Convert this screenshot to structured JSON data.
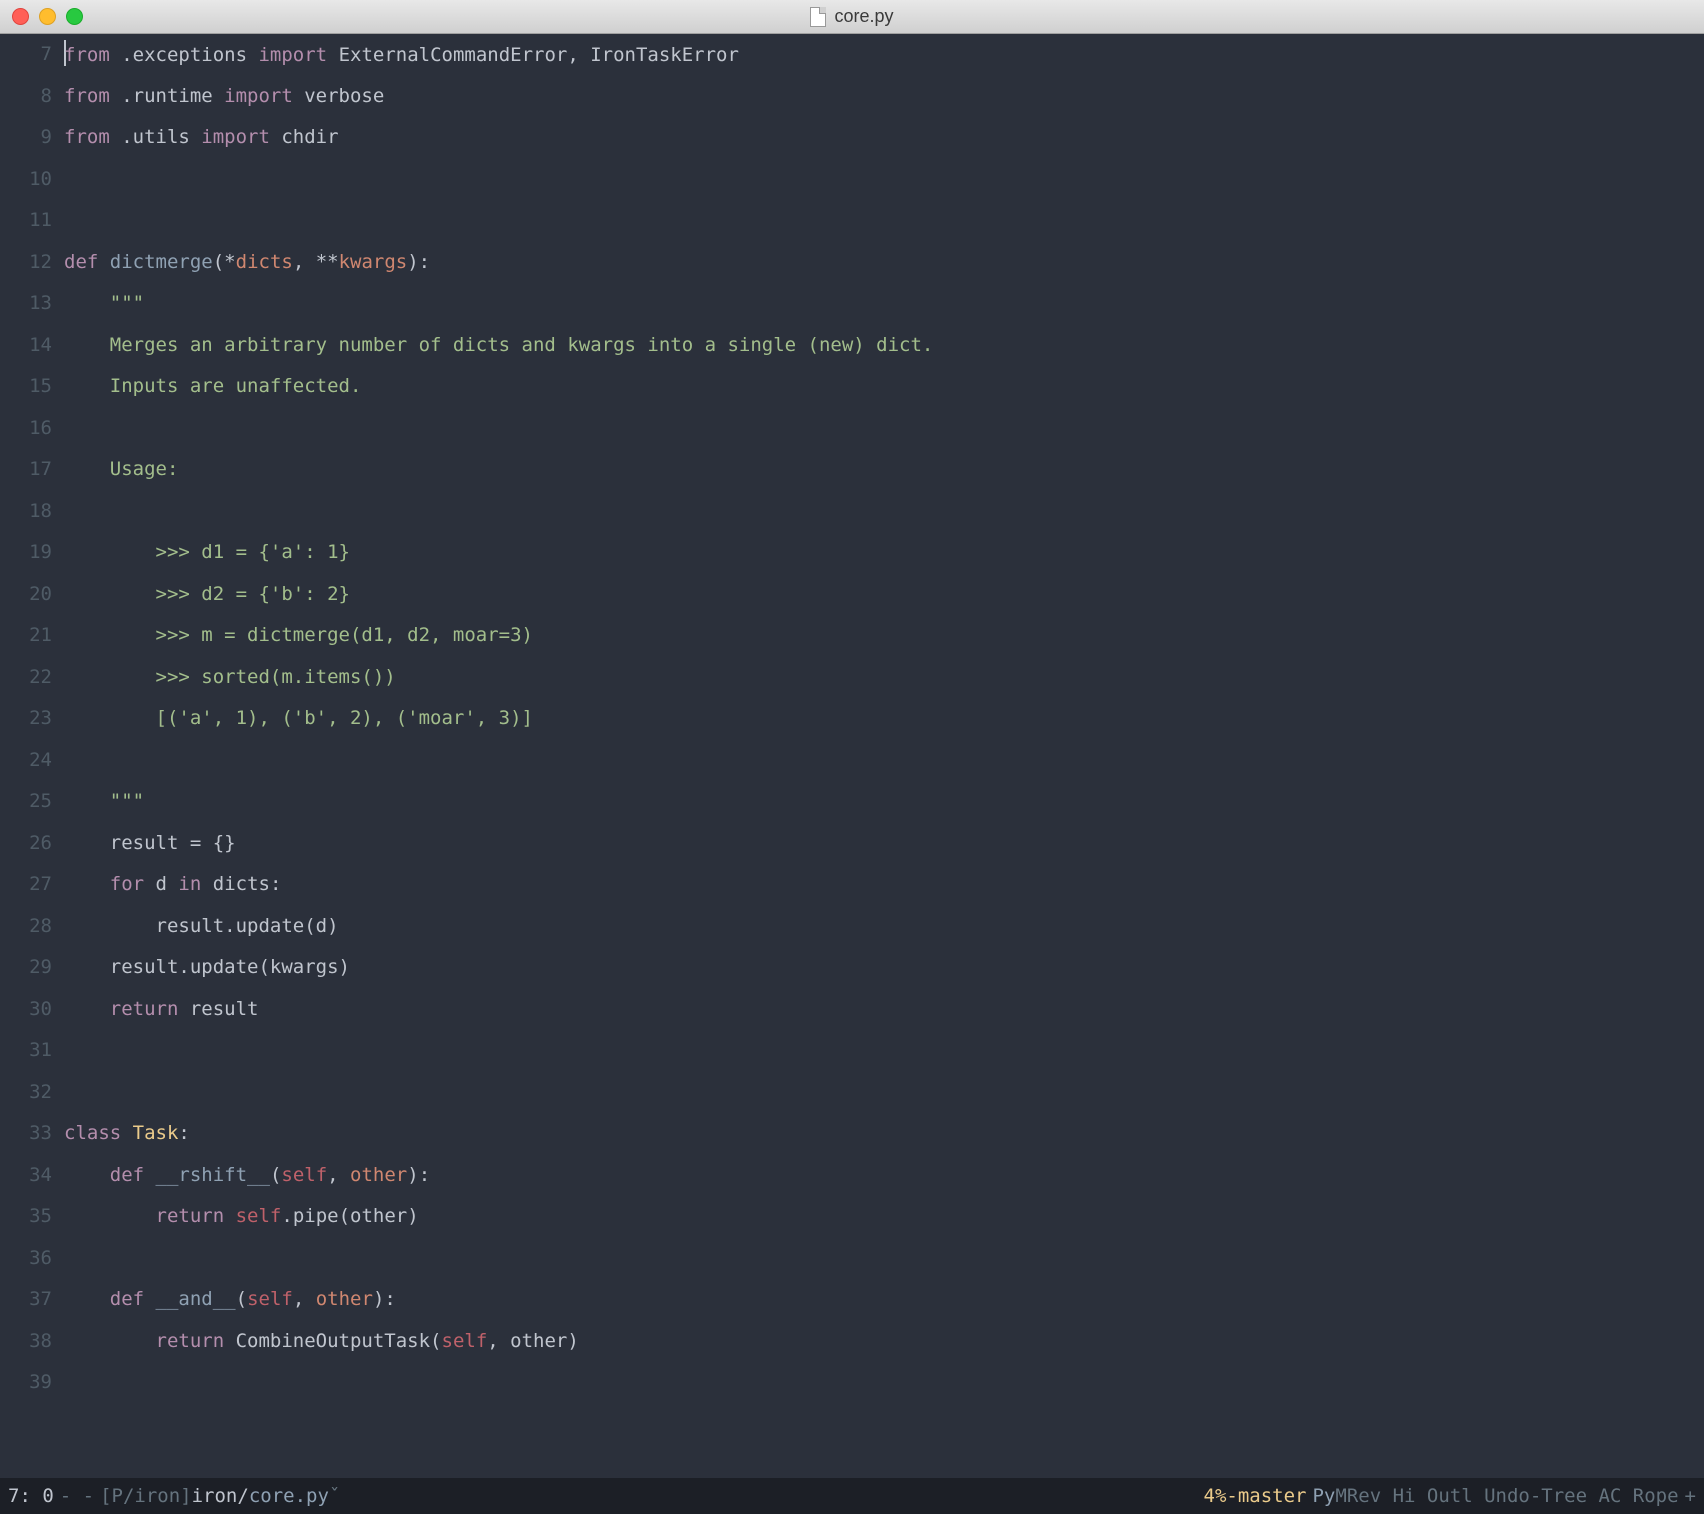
{
  "window": {
    "title": "core.py"
  },
  "gutter": {
    "start": 7,
    "end": 39
  },
  "code": {
    "lines": [
      {
        "n": 7,
        "tokens": [
          {
            "c": "kw",
            "t": "from"
          },
          {
            "c": "var",
            "t": " .exceptions "
          },
          {
            "c": "kw",
            "t": "import"
          },
          {
            "c": "var",
            "t": " ExternalCommandError, IronTaskError"
          }
        ],
        "cursor_before": true
      },
      {
        "n": 8,
        "tokens": [
          {
            "c": "kw",
            "t": "from"
          },
          {
            "c": "var",
            "t": " .runtime "
          },
          {
            "c": "kw",
            "t": "import"
          },
          {
            "c": "var",
            "t": " verbose"
          }
        ]
      },
      {
        "n": 9,
        "tokens": [
          {
            "c": "kw",
            "t": "from"
          },
          {
            "c": "var",
            "t": " .utils "
          },
          {
            "c": "kw",
            "t": "import"
          },
          {
            "c": "var",
            "t": " chdir"
          }
        ]
      },
      {
        "n": 10,
        "tokens": []
      },
      {
        "n": 11,
        "tokens": []
      },
      {
        "n": 12,
        "tokens": [
          {
            "c": "kw",
            "t": "def"
          },
          {
            "c": "var",
            "t": " "
          },
          {
            "c": "fn",
            "t": "dictmerge"
          },
          {
            "c": "var",
            "t": "(*"
          },
          {
            "c": "param",
            "t": "dicts"
          },
          {
            "c": "var",
            "t": ", **"
          },
          {
            "c": "param",
            "t": "kwargs"
          },
          {
            "c": "var",
            "t": "):"
          }
        ]
      },
      {
        "n": 13,
        "tokens": [
          {
            "c": "str",
            "t": "    \"\"\""
          }
        ]
      },
      {
        "n": 14,
        "tokens": [
          {
            "c": "str",
            "t": "    Merges an arbitrary number of dicts and kwargs into a single (new) dict."
          }
        ]
      },
      {
        "n": 15,
        "tokens": [
          {
            "c": "str",
            "t": "    Inputs are unaffected."
          }
        ]
      },
      {
        "n": 16,
        "tokens": []
      },
      {
        "n": 17,
        "tokens": [
          {
            "c": "str",
            "t": "    Usage:"
          }
        ]
      },
      {
        "n": 18,
        "tokens": []
      },
      {
        "n": 19,
        "tokens": [
          {
            "c": "str",
            "t": "        >>> d1 = {'a': 1}"
          }
        ]
      },
      {
        "n": 20,
        "tokens": [
          {
            "c": "str",
            "t": "        >>> d2 = {'b': 2}"
          }
        ]
      },
      {
        "n": 21,
        "tokens": [
          {
            "c": "str",
            "t": "        >>> m = dictmerge(d1, d2, moar=3)"
          }
        ]
      },
      {
        "n": 22,
        "tokens": [
          {
            "c": "str",
            "t": "        >>> sorted(m.items())"
          }
        ]
      },
      {
        "n": 23,
        "tokens": [
          {
            "c": "str",
            "t": "        [('a', 1), ('b', 2), ('moar', 3)]"
          }
        ]
      },
      {
        "n": 24,
        "tokens": []
      },
      {
        "n": 25,
        "tokens": [
          {
            "c": "str",
            "t": "    \"\"\""
          }
        ]
      },
      {
        "n": 26,
        "tokens": [
          {
            "c": "var",
            "t": "    result = {}"
          }
        ]
      },
      {
        "n": 27,
        "tokens": [
          {
            "c": "var",
            "t": "    "
          },
          {
            "c": "kw",
            "t": "for"
          },
          {
            "c": "var",
            "t": " d "
          },
          {
            "c": "kw",
            "t": "in"
          },
          {
            "c": "var",
            "t": " dicts:"
          }
        ]
      },
      {
        "n": 28,
        "tokens": [
          {
            "c": "var",
            "t": "        result.update(d)"
          }
        ]
      },
      {
        "n": 29,
        "tokens": [
          {
            "c": "var",
            "t": "    result.update(kwargs)"
          }
        ]
      },
      {
        "n": 30,
        "tokens": [
          {
            "c": "var",
            "t": "    "
          },
          {
            "c": "kw",
            "t": "return"
          },
          {
            "c": "var",
            "t": " result"
          }
        ]
      },
      {
        "n": 31,
        "tokens": []
      },
      {
        "n": 32,
        "tokens": []
      },
      {
        "n": 33,
        "tokens": [
          {
            "c": "kw",
            "t": "class"
          },
          {
            "c": "var",
            "t": " "
          },
          {
            "c": "cls",
            "t": "Task"
          },
          {
            "c": "var",
            "t": ":"
          }
        ]
      },
      {
        "n": 34,
        "tokens": [
          {
            "c": "var",
            "t": "    "
          },
          {
            "c": "kw",
            "t": "def"
          },
          {
            "c": "var",
            "t": " "
          },
          {
            "c": "fn",
            "t": "__rshift__"
          },
          {
            "c": "var",
            "t": "("
          },
          {
            "c": "self",
            "t": "self"
          },
          {
            "c": "var",
            "t": ", "
          },
          {
            "c": "param",
            "t": "other"
          },
          {
            "c": "var",
            "t": "):"
          }
        ]
      },
      {
        "n": 35,
        "tokens": [
          {
            "c": "var",
            "t": "        "
          },
          {
            "c": "kw",
            "t": "return"
          },
          {
            "c": "var",
            "t": " "
          },
          {
            "c": "self",
            "t": "self"
          },
          {
            "c": "var",
            "t": ".pipe(other)"
          }
        ]
      },
      {
        "n": 36,
        "tokens": []
      },
      {
        "n": 37,
        "tokens": [
          {
            "c": "var",
            "t": "    "
          },
          {
            "c": "kw",
            "t": "def"
          },
          {
            "c": "var",
            "t": " "
          },
          {
            "c": "fn",
            "t": "__and__"
          },
          {
            "c": "var",
            "t": "("
          },
          {
            "c": "self",
            "t": "self"
          },
          {
            "c": "var",
            "t": ", "
          },
          {
            "c": "param",
            "t": "other"
          },
          {
            "c": "var",
            "t": "):"
          }
        ]
      },
      {
        "n": 38,
        "tokens": [
          {
            "c": "var",
            "t": "        "
          },
          {
            "c": "kw",
            "t": "return"
          },
          {
            "c": "var",
            "t": " CombineOutputTask("
          },
          {
            "c": "self",
            "t": "self"
          },
          {
            "c": "var",
            "t": ", other)"
          }
        ]
      },
      {
        "n": 39,
        "tokens": []
      }
    ]
  },
  "modeline": {
    "pos": "7: 0",
    "sep1": " - -",
    "proj_prefix": "[P/iron]",
    "path": "iron/",
    "file": "core.py",
    "after_file": " ˇ",
    "percent": "4%",
    "branch": " -master",
    "major_mode": "Py",
    "minor_modes": " MRev Hi Outl Undo-Tree AC Rope",
    "plus": "+"
  }
}
